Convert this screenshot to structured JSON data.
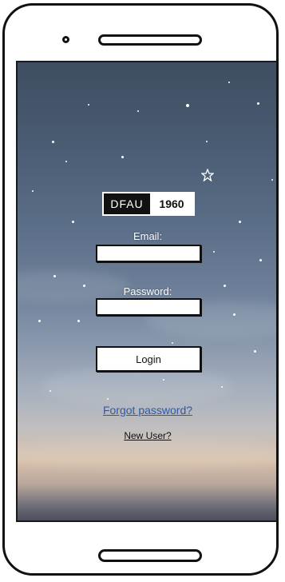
{
  "logo": {
    "left_text": "DFAU",
    "right_text": "1960"
  },
  "form": {
    "email_label": "Email:",
    "email_value": "",
    "password_label": "Password:",
    "password_value": "",
    "login_label": "Login"
  },
  "links": {
    "forgot_password": "Forgot password?",
    "new_user": "New User?"
  },
  "colors": {
    "link_blue": "#2d5aa8",
    "frame": "#111111"
  }
}
